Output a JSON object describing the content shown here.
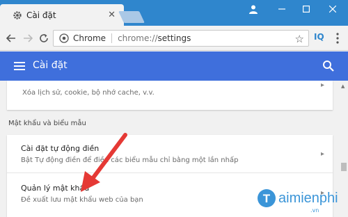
{
  "browser": {
    "tab_title": "Cài đặt",
    "site_name": "Chrome",
    "url_scheme": "chrome://",
    "url_path": "settings",
    "extension_label": "IQ"
  },
  "header": {
    "title": "Cài đặt"
  },
  "settings": {
    "top_row_desc": "Xóa lịch sử, cookie, bộ nhớ cache, v.v.",
    "section_label": "Mật khẩu và biểu mẫu",
    "autofill_title": "Cài đặt tự động điền",
    "autofill_desc": "Bật Tự động điền để điền các biểu mẫu chỉ bằng một lần nhấp",
    "passwords_title": "Quản lý mật khẩu",
    "passwords_desc": "Đề xuất lưu mật khẩu web của bạn"
  },
  "watermark": {
    "brand": "aimienphi",
    "suffix": ".vn"
  },
  "colors": {
    "tabstrip": "#2f86cd",
    "settings_header": "#3f6fdc",
    "annotation_arrow": "#e53935"
  },
  "icons": [
    "gear-icon",
    "close-icon",
    "back-icon",
    "forward-icon",
    "reload-icon",
    "chrome-site-icon",
    "star-icon",
    "menu-icon",
    "search-icon",
    "minimize-icon",
    "maximize-icon",
    "window-close-icon",
    "user-icon",
    "chevron-right-icon"
  ]
}
